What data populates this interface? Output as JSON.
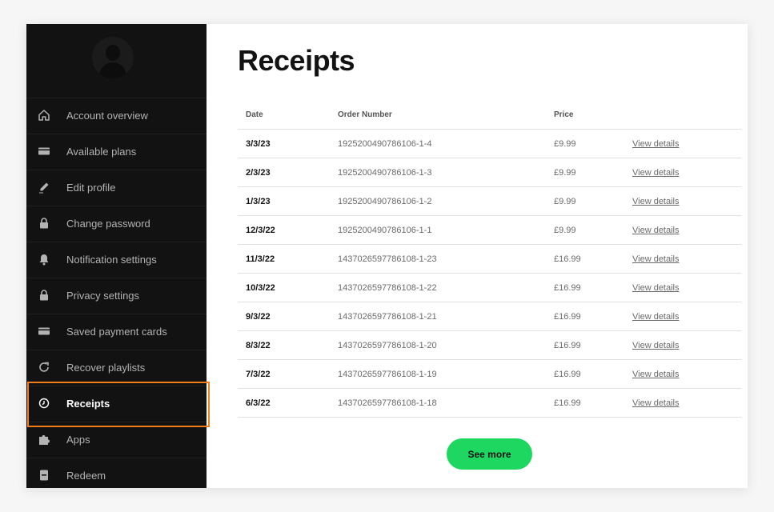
{
  "sidebar": {
    "items": [
      {
        "label": "Account overview",
        "icon": "home-icon",
        "active": false
      },
      {
        "label": "Available plans",
        "icon": "card-icon",
        "active": false
      },
      {
        "label": "Edit profile",
        "icon": "pencil-icon",
        "active": false
      },
      {
        "label": "Change password",
        "icon": "lock-icon",
        "active": false
      },
      {
        "label": "Notification settings",
        "icon": "bell-icon",
        "active": false
      },
      {
        "label": "Privacy settings",
        "icon": "lock-icon",
        "active": false
      },
      {
        "label": "Saved payment cards",
        "icon": "card-icon",
        "active": false
      },
      {
        "label": "Recover playlists",
        "icon": "refresh-icon",
        "active": false
      },
      {
        "label": "Receipts",
        "icon": "clock-icon",
        "active": true
      },
      {
        "label": "Apps",
        "icon": "puzzle-icon",
        "active": false
      },
      {
        "label": "Redeem",
        "icon": "redeem-icon",
        "active": false
      }
    ]
  },
  "main": {
    "title": "Receipts",
    "table": {
      "headers": {
        "date": "Date",
        "order": "Order Number",
        "price": "Price"
      },
      "rows": [
        {
          "date": "3/3/23",
          "order": "1925200490786106-1-4",
          "price": "£9.99",
          "link": "View details"
        },
        {
          "date": "2/3/23",
          "order": "1925200490786106-1-3",
          "price": "£9.99",
          "link": "View details"
        },
        {
          "date": "1/3/23",
          "order": "1925200490786106-1-2",
          "price": "£9.99",
          "link": "View details"
        },
        {
          "date": "12/3/22",
          "order": "1925200490786106-1-1",
          "price": "£9.99",
          "link": "View details"
        },
        {
          "date": "11/3/22",
          "order": "1437026597786108-1-23",
          "price": "£16.99",
          "link": "View details"
        },
        {
          "date": "10/3/22",
          "order": "1437026597786108-1-22",
          "price": "£16.99",
          "link": "View details"
        },
        {
          "date": "9/3/22",
          "order": "1437026597786108-1-21",
          "price": "£16.99",
          "link": "View details"
        },
        {
          "date": "8/3/22",
          "order": "1437026597786108-1-20",
          "price": "£16.99",
          "link": "View details"
        },
        {
          "date": "7/3/22",
          "order": "1437026597786108-1-19",
          "price": "£16.99",
          "link": "View details"
        },
        {
          "date": "6/3/22",
          "order": "1437026597786108-1-18",
          "price": "£16.99",
          "link": "View details"
        }
      ]
    },
    "see_more_label": "See more"
  },
  "colors": {
    "sidebar_bg": "#121212",
    "accent_green": "#1ed760",
    "highlight_orange": "#f07d1a"
  }
}
